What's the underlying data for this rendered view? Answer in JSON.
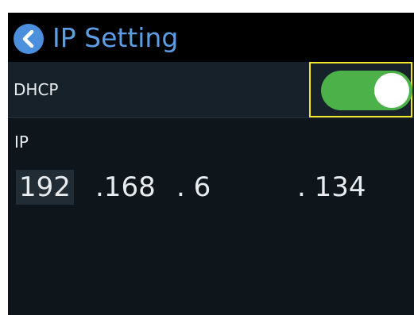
{
  "header": {
    "title": "IP Setting",
    "back_icon": "chevron-left-icon",
    "colors": {
      "title": "#5c9ee6",
      "back_button": "#4c8fdc"
    }
  },
  "dhcp": {
    "label": "DHCP",
    "enabled": true,
    "toggle_color": "#4db14a",
    "highlight_color": "#f1e829"
  },
  "ip": {
    "label": "IP",
    "octets": [
      "192",
      ".168",
      ". 6",
      ". 134"
    ]
  }
}
